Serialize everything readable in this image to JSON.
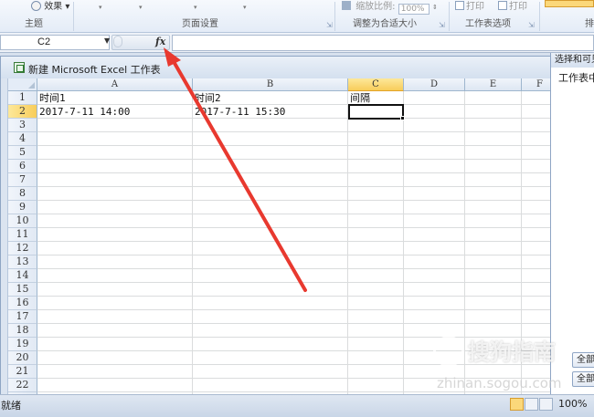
{
  "ribbon": {
    "effects_label": "效果",
    "theme_group": "主题",
    "page_setup_group": "页面设置",
    "scale_label": "缩放比例:",
    "scale_value": "100%",
    "fit_group": "调整为合适大小",
    "print1_label": "打印",
    "print2_label": "打印",
    "sheet_options_group": "工作表选项",
    "arrange_partial": "排"
  },
  "formula_bar": {
    "name_box_value": "C2",
    "fx_label": "fx",
    "formula_value": ""
  },
  "window": {
    "title": "新建 Microsoft Excel 工作表"
  },
  "grid": {
    "columns": [
      "A",
      "B",
      "C",
      "D",
      "E",
      "F"
    ],
    "rows": [
      "1",
      "2",
      "3",
      "4",
      "5",
      "6",
      "7",
      "8",
      "9",
      "10",
      "11",
      "12",
      "13",
      "14",
      "15",
      "16",
      "17",
      "18",
      "19",
      "20",
      "21",
      "22",
      "23"
    ],
    "active_cell": "C2",
    "cells": {
      "A1": "时间1",
      "B1": "时间2",
      "C1": "间隔",
      "A2": "2017-7-11 14:00",
      "B2": "2017-7-11 15:30"
    }
  },
  "side_pane": {
    "title": "选择和可见",
    "label": "工作表中",
    "button1": "全部",
    "button2": "全部"
  },
  "status_bar": {
    "ready": "就绪",
    "zoom": "100%",
    "zoom_minus": "−"
  },
  "watermark": {
    "text": "搜狗指南",
    "sub": "zhinan.sogou.com"
  },
  "colors": {
    "accent_arrow": "#e8392f",
    "active_header": "#f8cd5a"
  }
}
